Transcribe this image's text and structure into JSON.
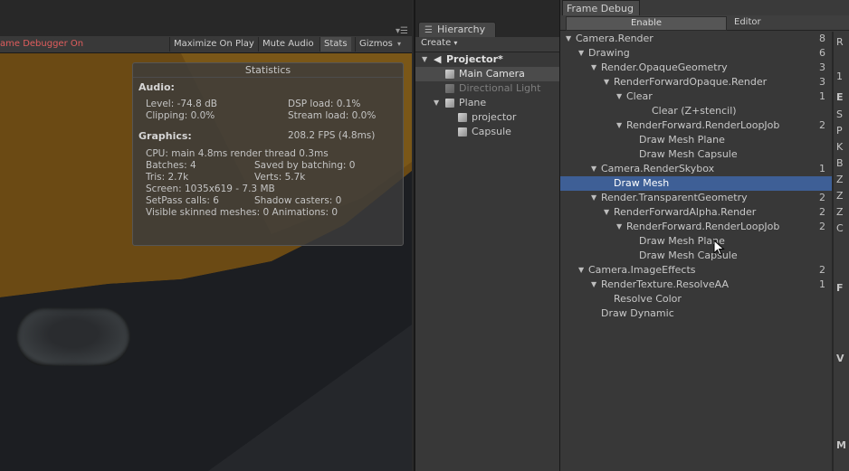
{
  "game_view": {
    "frame_debugger_status": "ame Debugger On",
    "buttons": [
      "Maximize On Play",
      "Mute Audio",
      "Stats",
      "Gizmos"
    ],
    "active_button": "Stats"
  },
  "statistics": {
    "title": "Statistics",
    "audio_header": "Audio:",
    "level": "Level: -74.8 dB",
    "dsp_load": "DSP load: 0.1%",
    "clipping": "Clipping: 0.0%",
    "stream_load": "Stream load: 0.0%",
    "graphics_header": "Graphics:",
    "fps": "208.2 FPS (4.8ms)",
    "cpu": "CPU: main 4.8ms  render thread 0.3ms",
    "batches": "Batches: 4",
    "saved_by_batching": "Saved by batching: 0",
    "tris": "Tris: 2.7k",
    "verts": "Verts: 5.7k",
    "screen": "Screen: 1035x619 - 7.3 MB",
    "setpass_calls": "SetPass calls: 6",
    "shadow_casters": "Shadow casters: 0",
    "visible_skinned": "Visible skinned meshes: 0  Animations: 0"
  },
  "hierarchy": {
    "tab_label": "Hierarchy",
    "create_label": "Create",
    "items": [
      {
        "label": "Projector*"
      },
      {
        "label": "Main Camera"
      },
      {
        "label": "Directional Light"
      },
      {
        "label": "Plane"
      },
      {
        "label": "projector"
      },
      {
        "label": "Capsule"
      }
    ]
  },
  "frame_debug": {
    "tab_label": "Frame Debug",
    "enable_label": "Enable",
    "editor_label": "Editor",
    "tree": [
      {
        "label": "Camera.Render",
        "count": "8"
      },
      {
        "label": "Drawing",
        "count": "6"
      },
      {
        "label": "Render.OpaqueGeometry",
        "count": "3"
      },
      {
        "label": "RenderForwardOpaque.Render",
        "count": "3"
      },
      {
        "label": "Clear",
        "count": "1"
      },
      {
        "label": "Clear (Z+stencil)",
        "count": ""
      },
      {
        "label": "RenderForward.RenderLoopJob",
        "count": "2"
      },
      {
        "label": "Draw Mesh Plane",
        "count": ""
      },
      {
        "label": "Draw Mesh Capsule",
        "count": ""
      },
      {
        "label": "Camera.RenderSkybox",
        "count": "1"
      },
      {
        "label": "Draw Mesh",
        "count": ""
      },
      {
        "label": "Render.TransparentGeometry",
        "count": "2"
      },
      {
        "label": "RenderForwardAlpha.Render",
        "count": "2"
      },
      {
        "label": "RenderForward.RenderLoopJob",
        "count": "2"
      },
      {
        "label": "Draw Mesh Plane",
        "count": ""
      },
      {
        "label": "Draw Mesh Capsule",
        "count": ""
      },
      {
        "label": "Camera.ImageEffects",
        "count": "2"
      },
      {
        "label": "RenderTexture.ResolveAA",
        "count": "1"
      },
      {
        "label": "Resolve Color",
        "count": ""
      },
      {
        "label": "Draw Dynamic",
        "count": ""
      }
    ],
    "details_chars": [
      "R",
      "1",
      "E",
      "S",
      "P",
      "K",
      "B",
      "Z",
      "Z",
      "Z",
      "C",
      "F",
      "V",
      "M"
    ]
  }
}
